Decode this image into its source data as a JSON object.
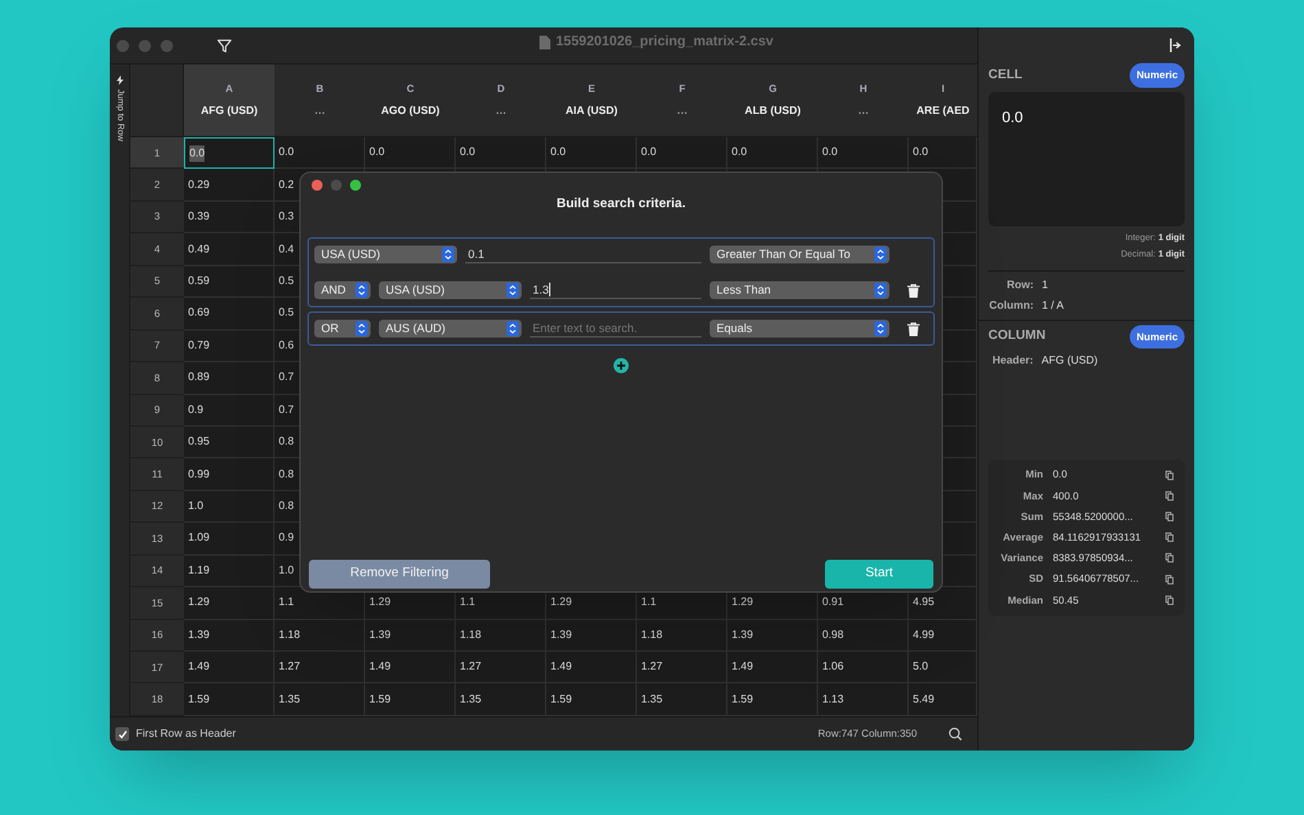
{
  "window": {
    "title": "1559201026_pricing_matrix-2.csv"
  },
  "side_strip": {
    "label": "Jump to Row"
  },
  "table": {
    "columns": [
      {
        "letter": "A",
        "header": "AFG (USD)",
        "selected": true
      },
      {
        "letter": "B",
        "header": "…",
        "selected": false
      },
      {
        "letter": "C",
        "header": "AGO (USD)",
        "selected": false
      },
      {
        "letter": "D",
        "header": "…",
        "selected": false
      },
      {
        "letter": "E",
        "header": "AIA (USD)",
        "selected": false
      },
      {
        "letter": "F",
        "header": "…",
        "selected": false
      },
      {
        "letter": "G",
        "header": "ALB (USD)",
        "selected": false
      },
      {
        "letter": "H",
        "header": "…",
        "selected": false
      },
      {
        "letter": "I",
        "header": "ARE (AED",
        "selected": false
      }
    ],
    "rows": [
      {
        "number": "1",
        "selected": true,
        "cells": [
          "0.0",
          "0.0",
          "0.0",
          "0.0",
          "0.0",
          "0.0",
          "0.0",
          "0.0",
          "0.0"
        ]
      },
      {
        "number": "2",
        "selected": false,
        "cells": [
          "0.29",
          "0.2"
        ]
      },
      {
        "number": "3",
        "selected": false,
        "cells": [
          "0.39",
          "0.3"
        ]
      },
      {
        "number": "4",
        "selected": false,
        "cells": [
          "0.49",
          "0.4"
        ]
      },
      {
        "number": "5",
        "selected": false,
        "cells": [
          "0.59",
          "0.5"
        ]
      },
      {
        "number": "6",
        "selected": false,
        "cells": [
          "0.69",
          "0.5"
        ]
      },
      {
        "number": "7",
        "selected": false,
        "cells": [
          "0.79",
          "0.6"
        ]
      },
      {
        "number": "8",
        "selected": false,
        "cells": [
          "0.89",
          "0.7"
        ]
      },
      {
        "number": "9",
        "selected": false,
        "cells": [
          "0.9",
          "0.7"
        ]
      },
      {
        "number": "10",
        "selected": false,
        "cells": [
          "0.95",
          "0.8"
        ]
      },
      {
        "number": "11",
        "selected": false,
        "cells": [
          "0.99",
          "0.8"
        ]
      },
      {
        "number": "12",
        "selected": false,
        "cells": [
          "1.0",
          "0.8"
        ]
      },
      {
        "number": "13",
        "selected": false,
        "cells": [
          "1.09",
          "0.9"
        ]
      },
      {
        "number": "14",
        "selected": false,
        "cells": [
          "1.19",
          "1.0"
        ]
      },
      {
        "number": "15",
        "selected": false,
        "cells": [
          "1.29",
          "1.1",
          "1.29",
          "1.1",
          "1.29",
          "1.1",
          "1.29",
          "0.91",
          "4.95"
        ]
      },
      {
        "number": "16",
        "selected": false,
        "cells": [
          "1.39",
          "1.18",
          "1.39",
          "1.18",
          "1.39",
          "1.18",
          "1.39",
          "0.98",
          "4.99"
        ]
      },
      {
        "number": "17",
        "selected": false,
        "cells": [
          "1.49",
          "1.27",
          "1.49",
          "1.27",
          "1.49",
          "1.27",
          "1.49",
          "1.06",
          "5.0"
        ]
      },
      {
        "number": "18",
        "selected": false,
        "cells": [
          "1.59",
          "1.35",
          "1.59",
          "1.35",
          "1.59",
          "1.35",
          "1.59",
          "1.13",
          "5.49"
        ]
      }
    ]
  },
  "dialog": {
    "title": "Build search criteria.",
    "groups": [
      {
        "criteria": [
          {
            "column": "USA (USD)",
            "value": "0.1",
            "operator": "Greater Than Or Equal To",
            "focused": false,
            "deletable": false
          },
          {
            "conjunction": "AND",
            "column": "USA (USD)",
            "value": "1.3",
            "operator": "Less Than",
            "focused": true,
            "deletable": true
          }
        ]
      },
      {
        "criteria": [
          {
            "conjunction": "OR",
            "column": "AUS (AUD)",
            "placeholder": "Enter text to search.",
            "operator": "Equals",
            "focused": false,
            "deletable": true
          }
        ]
      }
    ],
    "buttons": [
      {
        "kind": "secondary",
        "label": "Remove Filtering"
      },
      {
        "kind": "primary",
        "label": "Start"
      }
    ]
  },
  "inspector": {
    "cell": {
      "heading": "CELL",
      "type": "Numeric",
      "value": "0.0",
      "details": [
        {
          "label": "Integer:",
          "value": "1 digit"
        },
        {
          "label": "Decimal:",
          "value": "1 digit"
        }
      ],
      "position": [
        {
          "label": "Row:",
          "value": "1"
        },
        {
          "label": "Column:",
          "value": "1 / A"
        }
      ]
    },
    "column": {
      "heading": "COLUMN",
      "type": "Numeric",
      "header_label": "Header:",
      "header": "AFG (USD)",
      "stats": [
        {
          "label": "Min",
          "value": "0.0"
        },
        {
          "label": "Max",
          "value": "400.0"
        },
        {
          "label": "Sum",
          "value": "55348.5200000..."
        },
        {
          "label": "Average",
          "value": "84.1162917933131"
        },
        {
          "label": "Variance",
          "value": "8383.97850934..."
        },
        {
          "label": "SD",
          "value": "91.56406778507..."
        },
        {
          "label": "Median",
          "value": "50.45"
        }
      ]
    }
  },
  "status_bar": {
    "first_row_as_header": {
      "label": "First Row as Header",
      "checked": true
    },
    "counts": "Row:747 Column:350"
  }
}
